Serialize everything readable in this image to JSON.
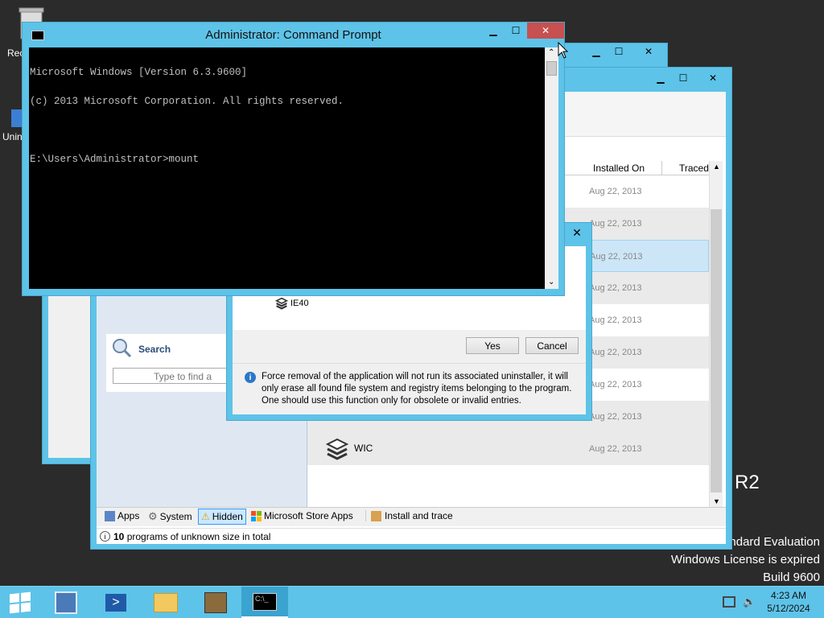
{
  "desktop": {
    "icon1_label": "Rec",
    "icon2_label": "Unin",
    "watermark_r2": "R2",
    "line1": "ndard Evaluation",
    "line2": "Windows License is expired",
    "line3": "Build 9600"
  },
  "back_window": {
    "search_label": "Search",
    "search_placeholder": "Type to find a pro",
    "columns": [
      "Installed On",
      "Traced"
    ],
    "rows": [
      {
        "date": "Aug 22, 2013"
      },
      {
        "date": "Aug 22, 2013"
      },
      {
        "date": "Aug 22, 2013"
      },
      {
        "date": "Aug 22, 2013"
      },
      {
        "date": "Aug 22, 2013"
      },
      {
        "date": "Aug 22, 2013"
      },
      {
        "date": "Aug 22, 2013"
      },
      {
        "date": "Aug 22, 2013"
      },
      {
        "date": "Aug 22, 2013",
        "name": "WIC"
      }
    ],
    "tabs": [
      "Apps",
      "System",
      "Hidden",
      "Microsoft Store Apps",
      "Install and trace"
    ],
    "status_count": "10",
    "status_text": " programs of unknown size in total"
  },
  "dialog": {
    "item_label": "IE40",
    "yes_label": "Yes",
    "cancel_label": "Cancel",
    "info_text": "Force removal of the application will not run its associated uninstaller, it will only erase all found file system and registry items belonging to the program. One should use this function only for obsolete or invalid entries."
  },
  "cmd": {
    "title": "Administrator: Command Prompt",
    "line1": "Microsoft Windows [Version 6.3.9600]",
    "line2": "(c) 2013 Microsoft Corporation. All rights reserved.",
    "line3": "E:\\Users\\Administrator>mount"
  },
  "taskbar": {
    "time": "4:23 AM",
    "date": "5/12/2024"
  },
  "colors": {
    "accent": "#5ec3e8",
    "taskbar": "#5ec3e8",
    "close": "#c75050",
    "console": "#000000"
  }
}
